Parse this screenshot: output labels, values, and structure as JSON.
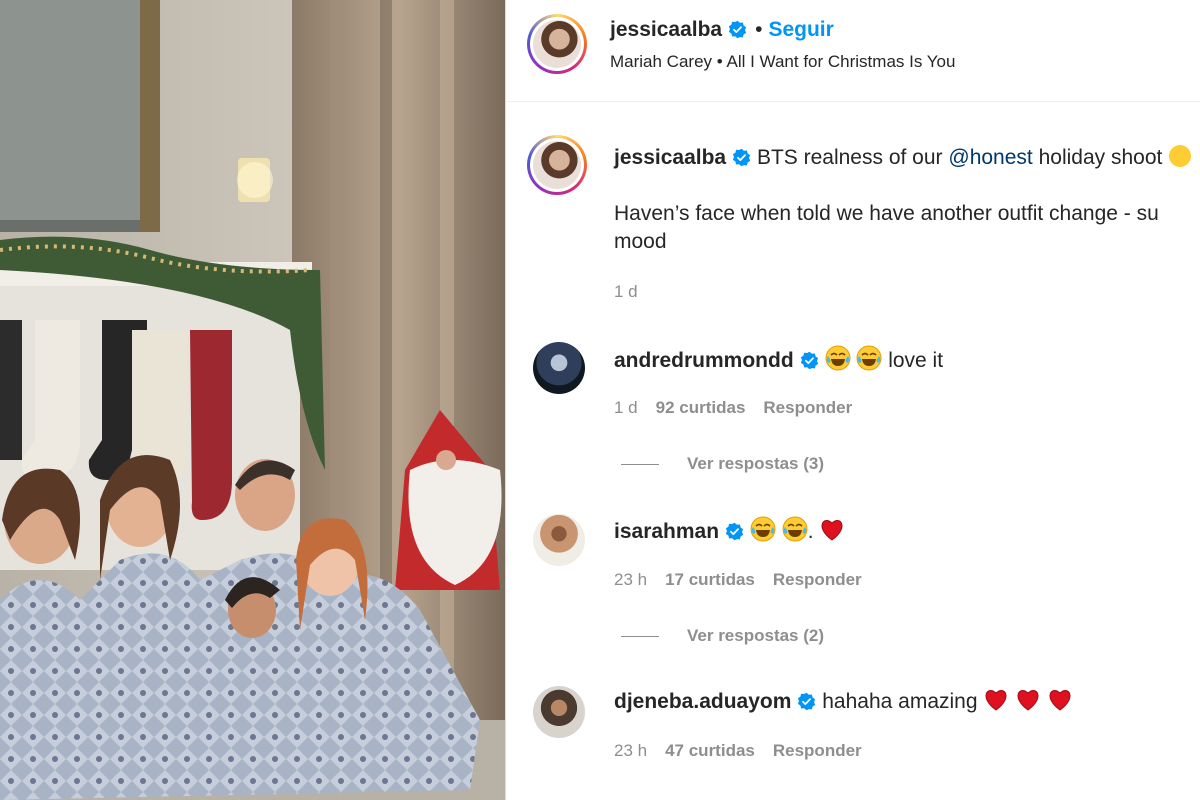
{
  "post": {
    "author": "jessicaalba",
    "follow_label": "Seguir",
    "audio": "Mariah Carey • All I Want for Christmas Is You",
    "caption_author": "jessicaalba",
    "caption_prefix": "BTS realness of our",
    "caption_mention": "@honest",
    "caption_suffix": "holiday shoot",
    "caption_line2": "Haven’s face when told we have another outfit change - su",
    "caption_line3": "mood",
    "time": "1 d"
  },
  "comments": [
    {
      "username": "andredrummondd",
      "text": "love it",
      "time": "1 d",
      "likes": "92 curtidas",
      "reply_label": "Responder",
      "view_replies": "Ver respostas (3)"
    },
    {
      "username": "isarahman",
      "text": ".",
      "time": "23 h",
      "likes": "17 curtidas",
      "reply_label": "Responder",
      "view_replies": "Ver respostas (2)"
    },
    {
      "username": "djeneba.aduayom",
      "text": "hahaha amazing",
      "time": "23 h",
      "likes": "47 curtidas",
      "reply_label": "Responder"
    }
  ],
  "icons": {
    "verified": "verified-badge-icon",
    "laugh": "tears-of-joy-emoji",
    "heart": "red-heart-emoji"
  },
  "colors": {
    "link_blue": "#0095f6",
    "verified": "#0095f6",
    "mention": "#00376b",
    "muted": "#8e8e8e",
    "heart": "#e0111f"
  }
}
